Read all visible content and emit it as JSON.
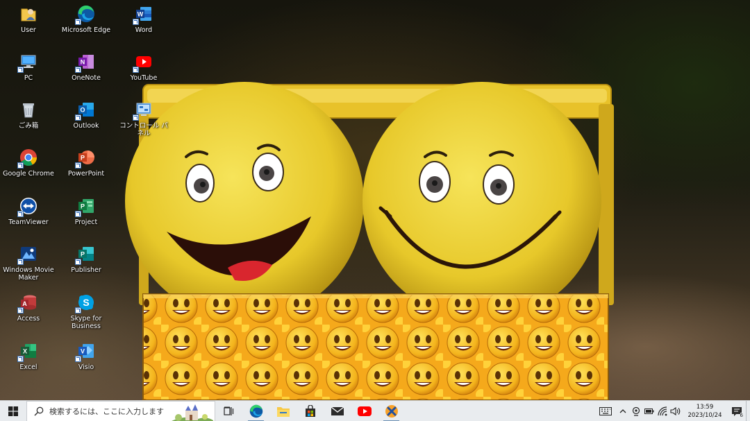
{
  "desktop": {
    "icons": [
      {
        "label": "User",
        "icon": "user-folder-icon"
      },
      {
        "label": "Microsoft Edge",
        "icon": "edge-icon"
      },
      {
        "label": "Word",
        "icon": "word-icon"
      },
      {
        "label": "PC",
        "icon": "pc-icon"
      },
      {
        "label": "OneNote",
        "icon": "onenote-icon"
      },
      {
        "label": "YouTube",
        "icon": "youtube-icon"
      },
      {
        "label": "ごみ箱",
        "icon": "recycle-bin-icon"
      },
      {
        "label": "Outlook",
        "icon": "outlook-icon"
      },
      {
        "label": "コントロール パネル",
        "icon": "control-panel-icon"
      },
      {
        "label": "Google Chrome",
        "icon": "chrome-icon"
      },
      {
        "label": "PowerPoint",
        "icon": "powerpoint-icon"
      },
      {
        "label": "TeamViewer",
        "icon": "teamviewer-icon"
      },
      {
        "label": "Project",
        "icon": "project-icon"
      },
      {
        "label": "Windows Movie Maker",
        "icon": "movie-maker-icon"
      },
      {
        "label": "Publisher",
        "icon": "publisher-icon"
      },
      {
        "label": "Access",
        "icon": "access-icon"
      },
      {
        "label": "Skype for Business",
        "icon": "skype-icon"
      },
      {
        "label": "Excel",
        "icon": "excel-icon"
      },
      {
        "label": "Visio",
        "icon": "visio-icon"
      }
    ]
  },
  "taskbar": {
    "search_placeholder": "検索するには、ここに入力します",
    "apps": [
      {
        "icon": "task-view-icon",
        "running": false
      },
      {
        "icon": "edge-icon",
        "running": true
      },
      {
        "icon": "file-explorer-icon",
        "running": false
      },
      {
        "icon": "microsoft-store-icon",
        "running": false
      },
      {
        "icon": "mail-icon",
        "running": false
      },
      {
        "icon": "youtube-icon",
        "running": false
      },
      {
        "icon": "xampp-icon",
        "running": true
      }
    ],
    "tray": {
      "time": "13:59",
      "date": "2023/10/24",
      "notification_count": "6"
    }
  },
  "colors": {
    "taskbar_bg": "#e9ecef",
    "accent_blue": "#0078d4"
  }
}
